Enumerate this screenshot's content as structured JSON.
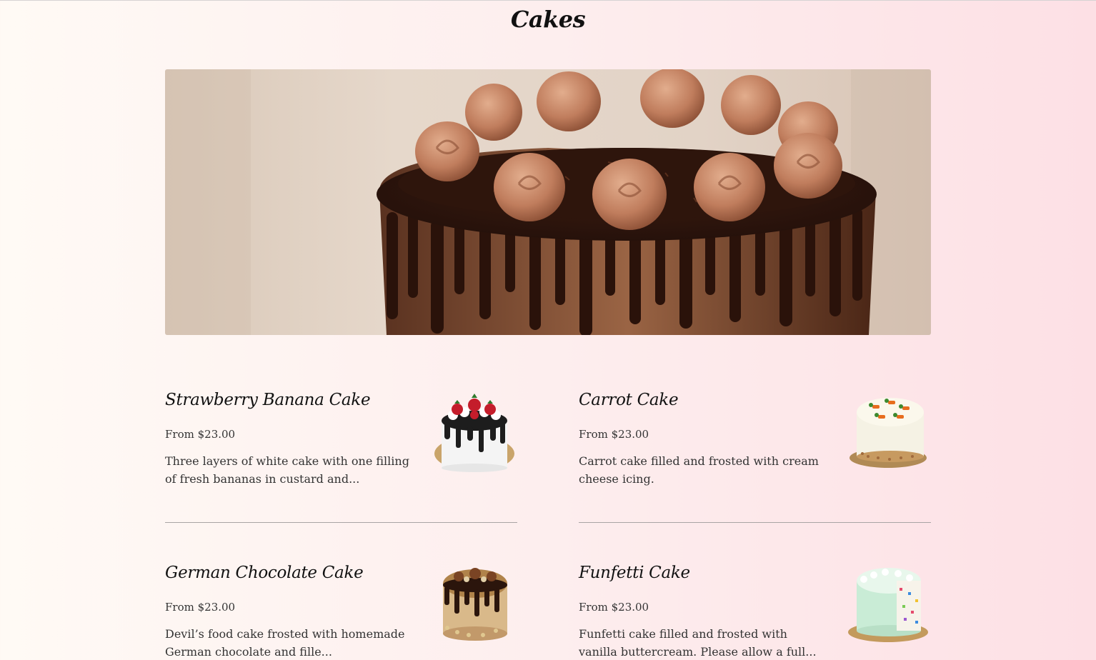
{
  "page": {
    "title": "Cakes"
  },
  "hero": {
    "icon": "chocolate-cake-photo"
  },
  "items": [
    {
      "title": "Strawberry Banana Cake",
      "price": "From $23.00",
      "description": "Three layers of white cake with one filling of fresh bananas in custard and...",
      "icon": "strawberry-banana-cake-thumbnail"
    },
    {
      "title": "Carrot Cake",
      "price": "From $23.00",
      "description": "Carrot cake filled and frosted with cream cheese icing.",
      "icon": "carrot-cake-thumbnail"
    },
    {
      "title": "German Chocolate Cake",
      "price": "From $23.00",
      "description": "Devil’s food cake frosted with homemade German chocolate and fille...",
      "icon": "german-chocolate-cake-thumbnail"
    },
    {
      "title": "Funfetti Cake",
      "price": "From $23.00",
      "description": "Funfetti cake filled and frosted with vanilla buttercream. Please allow a full...",
      "icon": "funfetti-cake-thumbnail"
    }
  ],
  "colors": {
    "background_left": "#fffaf5",
    "background_right": "#fde0e5",
    "text": "#111111",
    "divider": "#a9a4a4"
  }
}
